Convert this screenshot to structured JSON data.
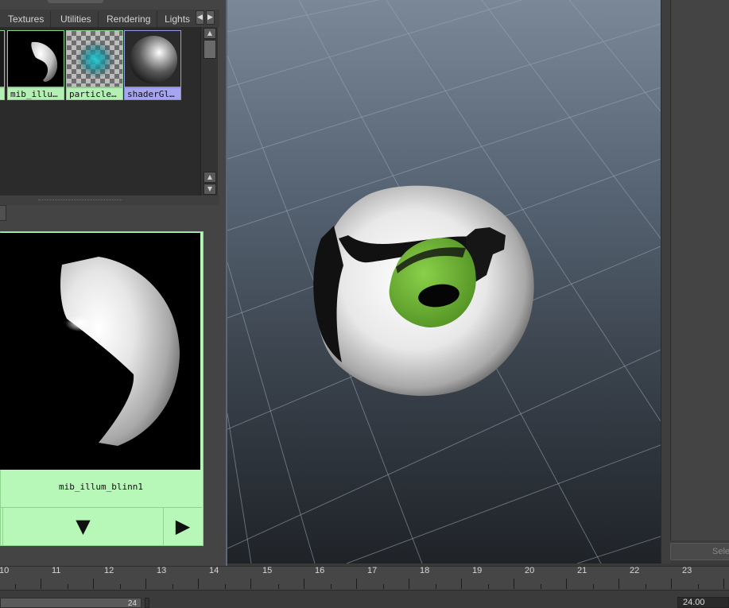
{
  "hypershade": {
    "tabs": [
      "Textures",
      "Utilities",
      "Rendering",
      "Lights"
    ],
    "swatches": [
      {
        "label": "mib_illu…",
        "icon": "mib-illum-swatch",
        "selected": false
      },
      {
        "label": "particle…",
        "icon": "particle-checker-swatch",
        "selected": false
      },
      {
        "label": "shaderGl…",
        "icon": "shader-glow-swatch",
        "selected": true
      }
    ],
    "preview": {
      "material_name": "mib_illum_blinn1",
      "down_glyph": "▼",
      "play_glyph": "▶"
    },
    "colors": {
      "swatch_label_bg": "#b4f0b4",
      "selected_label_bg": "#a6a6f0"
    }
  },
  "viewport": {
    "object": "green-eyeball-sphere",
    "colors": {
      "iris": "#6db53a",
      "sphere": "#f0f0f0"
    }
  },
  "side_panel": {
    "select_label": "Select"
  },
  "timeline": {
    "ticks": [
      "10",
      "11",
      "12",
      "13",
      "14",
      "15",
      "16",
      "17",
      "18",
      "19",
      "20",
      "21",
      "22",
      "23"
    ],
    "range_end": "24",
    "current_frame": "24.00"
  }
}
